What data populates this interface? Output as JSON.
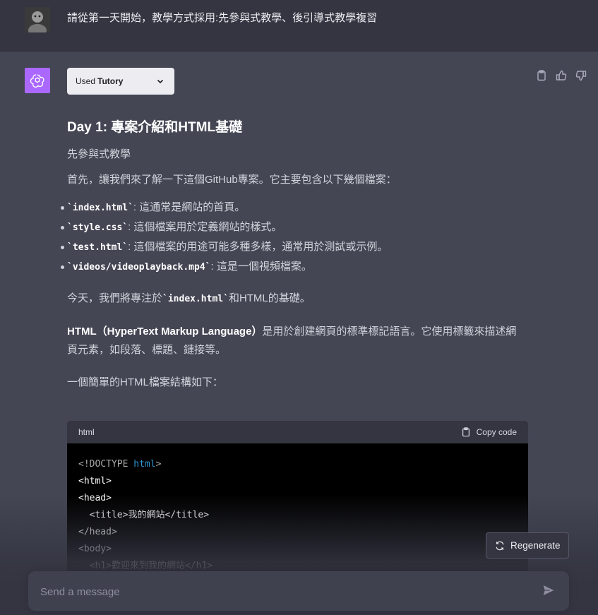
{
  "user_message": "請從第一天開始，教學方式採用:先參與式教學、後引導式教學複習",
  "plugin": {
    "prefix": "Used",
    "name": "Tutory"
  },
  "answer": {
    "title": "Day 1: 專案介紹和HTML基礎",
    "section1": "先參與式教學",
    "intro": "首先，讓我們來了解一下這個GitHub專案。它主要包含以下幾個檔案：",
    "files": [
      {
        "code": "`index.html`",
        "desc": ": 這通常是網站的首頁。"
      },
      {
        "code": "`style.css`",
        "desc": ": 這個檔案用於定義網站的樣式。"
      },
      {
        "code": "`test.html`",
        "desc": ": 這個檔案的用途可能多種多樣，通常用於測試或示例。"
      },
      {
        "code": "`videos/videoplayback.mp4`",
        "desc": ": 這是一個視頻檔案。"
      }
    ],
    "focus_pre": "今天，我們將專注於",
    "focus_code": "`index.html`",
    "focus_post": "和HTML的基礎。",
    "html_bold": "HTML（HyperText Markup Language）",
    "html_desc": "是用於創建網頁的標準標記語言。它使用標籤來描述網頁元素，如段落、標題、鏈接等。",
    "structure_intro": "一個簡單的HTML檔案結構如下："
  },
  "code_block": {
    "lang": "html",
    "copy_label": "Copy code",
    "lines": [
      {
        "a": "<!DOCTYPE ",
        "b": "html",
        "c": ">"
      },
      {
        "a": "<html>",
        "b": "",
        "c": ""
      },
      {
        "a": "<head>",
        "b": "",
        "c": ""
      },
      {
        "a": "  <title>我的網站</title>",
        "b": "",
        "c": ""
      },
      {
        "a": "</head>",
        "b": "",
        "c": ""
      },
      {
        "a": "<body>",
        "b": "",
        "c": ""
      },
      {
        "a": "  <h1>歡迎來到我的網站</h1>",
        "b": "",
        "c": ""
      }
    ]
  },
  "regenerate_label": "Regenerate",
  "input": {
    "placeholder": "Send a message"
  },
  "colors": {
    "accent": "#ab68ff",
    "keyword": "#2e95d3",
    "bg_bot": "#444654",
    "bg_user": "#343541"
  }
}
